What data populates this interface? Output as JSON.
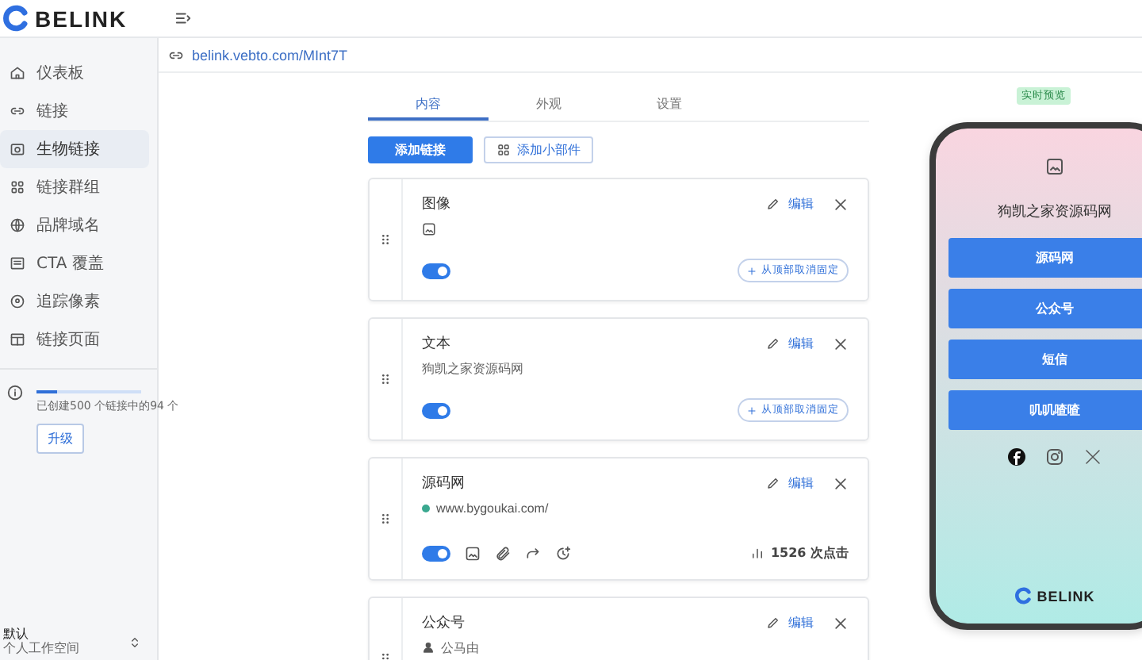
{
  "brand": {
    "name": "BELINK"
  },
  "sidebar": {
    "items": [
      {
        "label": "仪表板",
        "selected": false
      },
      {
        "label": "链接",
        "selected": false
      },
      {
        "label": "生物链接",
        "selected": true
      },
      {
        "label": "链接群组",
        "selected": false
      },
      {
        "label": "品牌域名",
        "selected": false
      },
      {
        "label": "CTA 覆盖",
        "selected": false
      },
      {
        "label": "追踪像素",
        "selected": false
      },
      {
        "label": "链接页面",
        "selected": false
      }
    ],
    "usage": {
      "text": "已创建500 个链接中的94 个",
      "level": 0.19,
      "button": "升级"
    },
    "workspace": {
      "name": "默认",
      "subtitle": "个人工作空间"
    }
  },
  "url": "belink.vebto.com/MInt7T",
  "tabs": [
    {
      "label": "内容",
      "selected": true
    },
    {
      "label": "外观",
      "selected": false
    },
    {
      "label": "设置",
      "selected": false
    }
  ],
  "actions": {
    "add_link": "添加链接",
    "add_widget": "添加小部件"
  },
  "blocks": [
    {
      "kind": "image",
      "title": "图像",
      "enabled": true,
      "edit": "编辑",
      "pin": "从顶部取消固定"
    },
    {
      "kind": "text",
      "title": "文本",
      "description": "狗凯之家资源码网",
      "enabled": true,
      "edit": "编辑",
      "pin": "从顶部取消固定"
    },
    {
      "kind": "link",
      "title": "源码网",
      "url": "www.bygoukai.com/",
      "enabled": true,
      "edit": "编辑",
      "clicks": "1526 次点击"
    },
    {
      "kind": "social",
      "title": "公众号",
      "subtitle": "公马由",
      "edit": "编辑"
    }
  ],
  "preview": {
    "badge": "实时预览",
    "heading": "狗凯之家资源码网",
    "buttons": [
      "源码网",
      "公众号",
      "短信",
      "叽叽喳喳"
    ],
    "brand": "BELINK"
  }
}
